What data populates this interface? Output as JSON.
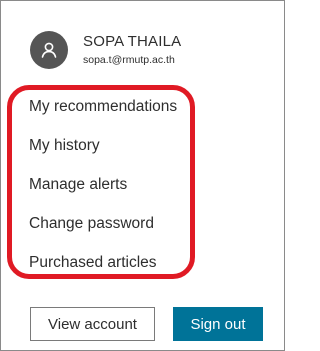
{
  "user": {
    "name": "SOPA THAILA",
    "email": "sopa.t@rmutp.ac.th",
    "avatar_icon": "user-icon"
  },
  "menu": {
    "items": [
      {
        "label": "My recommendations"
      },
      {
        "label": "My history"
      },
      {
        "label": "Manage alerts"
      },
      {
        "label": "Change password"
      },
      {
        "label": "Purchased articles"
      }
    ]
  },
  "buttons": {
    "view_account": "View account",
    "sign_out": "Sign out"
  },
  "colors": {
    "highlight_border": "#e01a24",
    "sign_out_bg": "#007398",
    "avatar_bg": "#555555"
  }
}
